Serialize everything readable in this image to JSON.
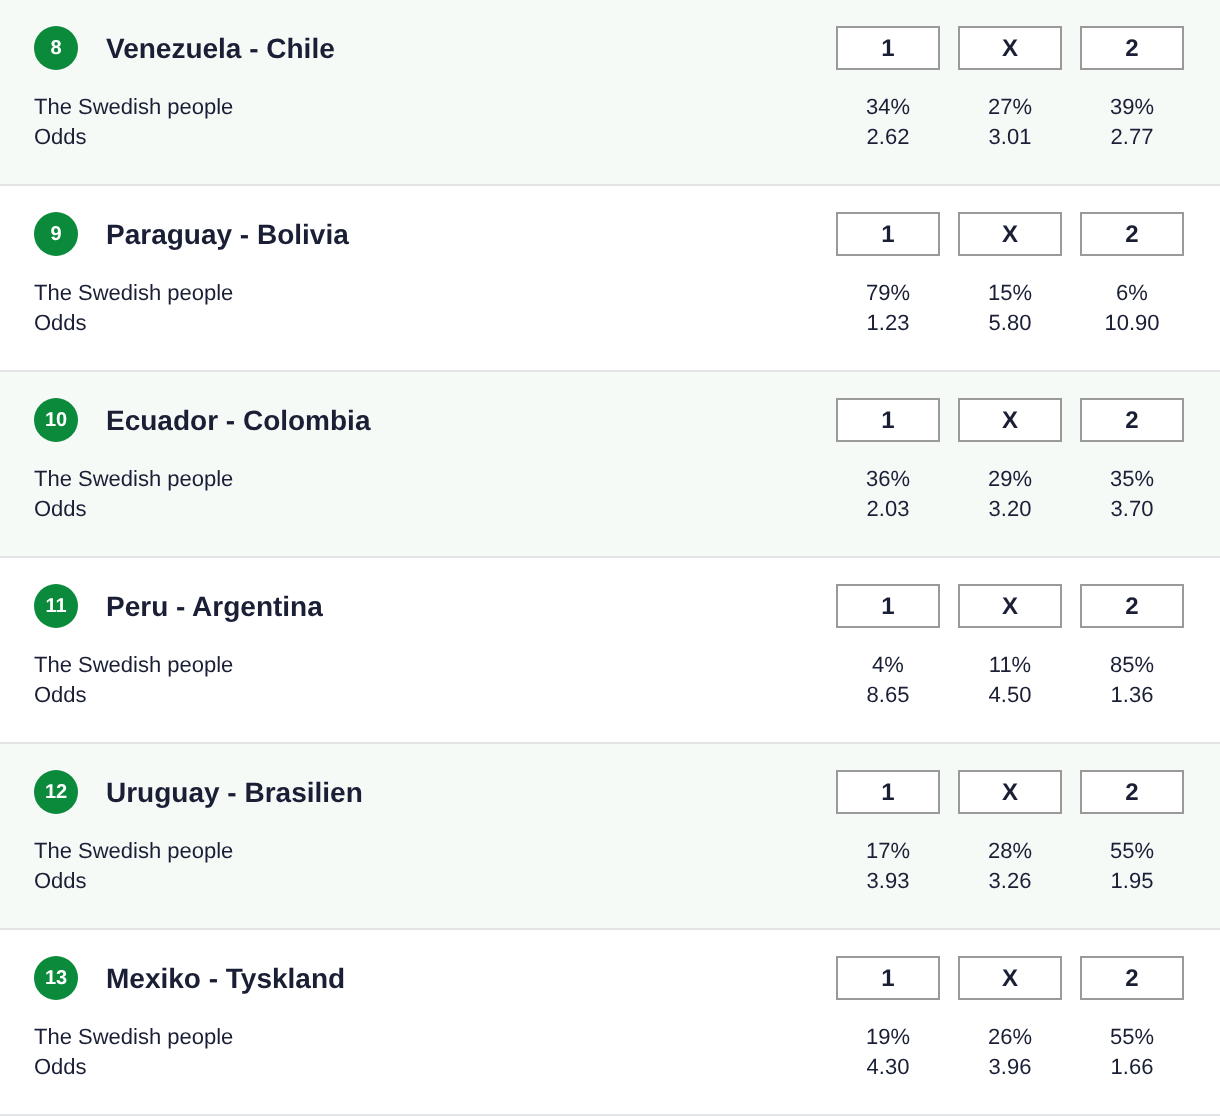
{
  "matches": [
    {
      "number": "8",
      "teams": "Venezuela - Chile",
      "buttons": [
        "1",
        "X",
        "2"
      ],
      "people_label": "The Swedish people",
      "people": [
        "34%",
        "27%",
        "39%"
      ],
      "odds_label": "Odds",
      "odds": [
        "2.62",
        "3.01",
        "2.77"
      ]
    },
    {
      "number": "9",
      "teams": "Paraguay - Bolivia",
      "buttons": [
        "1",
        "X",
        "2"
      ],
      "people_label": "The Swedish people",
      "people": [
        "79%",
        "15%",
        "6%"
      ],
      "odds_label": "Odds",
      "odds": [
        "1.23",
        "5.80",
        "10.90"
      ]
    },
    {
      "number": "10",
      "teams": "Ecuador - Colombia",
      "buttons": [
        "1",
        "X",
        "2"
      ],
      "people_label": "The Swedish people",
      "people": [
        "36%",
        "29%",
        "35%"
      ],
      "odds_label": "Odds",
      "odds": [
        "2.03",
        "3.20",
        "3.70"
      ]
    },
    {
      "number": "11",
      "teams": "Peru - Argentina",
      "buttons": [
        "1",
        "X",
        "2"
      ],
      "people_label": "The Swedish people",
      "people": [
        "4%",
        "11%",
        "85%"
      ],
      "odds_label": "Odds",
      "odds": [
        "8.65",
        "4.50",
        "1.36"
      ]
    },
    {
      "number": "12",
      "teams": "Uruguay - Brasilien",
      "buttons": [
        "1",
        "X",
        "2"
      ],
      "people_label": "The Swedish people",
      "people": [
        "17%",
        "28%",
        "55%"
      ],
      "odds_label": "Odds",
      "odds": [
        "3.93",
        "3.26",
        "1.95"
      ]
    },
    {
      "number": "13",
      "teams": "Mexiko - Tyskland",
      "buttons": [
        "1",
        "X",
        "2"
      ],
      "people_label": "The Swedish people",
      "people": [
        "19%",
        "26%",
        "55%"
      ],
      "odds_label": "Odds",
      "odds": [
        "4.30",
        "3.96",
        "1.66"
      ]
    }
  ]
}
